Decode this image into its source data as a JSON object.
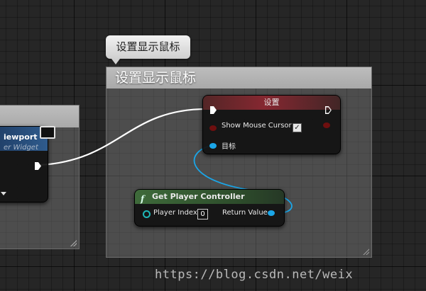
{
  "comment_bubble": {
    "text": "设置显示鼠标"
  },
  "comment_box": {
    "title": "设置显示鼠标"
  },
  "set_node": {
    "title": "设置",
    "show_mouse_cursor_label": "Show Mouse Cursor",
    "target_label": "目标",
    "checkbox_mark": "✓"
  },
  "get_player_controller_node": {
    "icon_glyph": "f",
    "title": "Get Player Controller",
    "player_index_label": "Player Index",
    "player_index_value": "0",
    "return_value_label": "Return Value"
  },
  "viewport_node": {
    "title": "iewport",
    "subtitle": "er Widget"
  },
  "watermark": {
    "text": "https://blog.csdn.net/weix"
  },
  "colors": {
    "exec_wire": "#ffffff",
    "object_wire": "#1ba6e8",
    "bool_pin": "#6e0f0f",
    "function_header": "#3e6a3a"
  },
  "icons": [
    "exec-pin",
    "object-pin",
    "bool-pin",
    "int-pin",
    "function-icon",
    "monitor-icon",
    "resize-grip"
  ]
}
